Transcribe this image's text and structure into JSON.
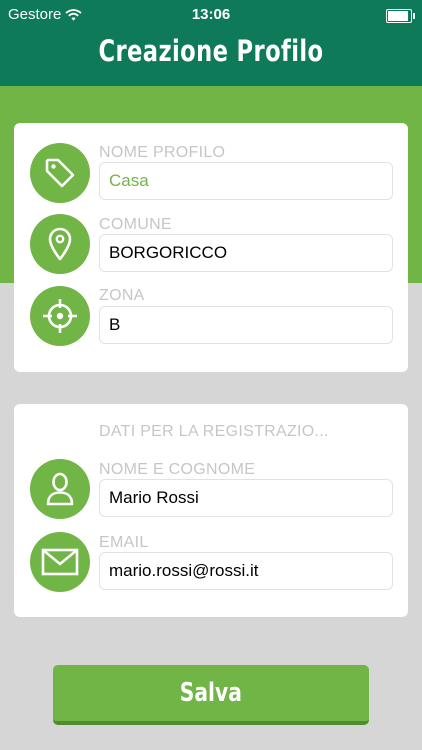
{
  "status_bar": {
    "carrier": "Gestore",
    "time": "13:06"
  },
  "header": {
    "title": "Creazione Profilo"
  },
  "profile_card": {
    "name_label": "NOME PROFILO",
    "name_value": "Casa",
    "comune_label": "COMUNE",
    "comune_value": "BORGORICCO",
    "zona_label": "ZONA",
    "zona_value": "B"
  },
  "registration_card": {
    "section_title": "DATI PER LA REGISTRAZIO...",
    "fullname_label": "NOME E COGNOME",
    "fullname_value": "Mario Rossi",
    "email_label": "EMAIL",
    "email_value": "mario.rossi@rossi.it"
  },
  "save_button": {
    "label": "Salva"
  },
  "colors": {
    "header": "#0f7a5a",
    "accent": "#70b545",
    "background": "#d6d6d6"
  },
  "icons": [
    "wifi-icon",
    "battery-icon",
    "tag-icon",
    "location-pin-icon",
    "crosshair-icon",
    "user-icon",
    "envelope-icon"
  ]
}
